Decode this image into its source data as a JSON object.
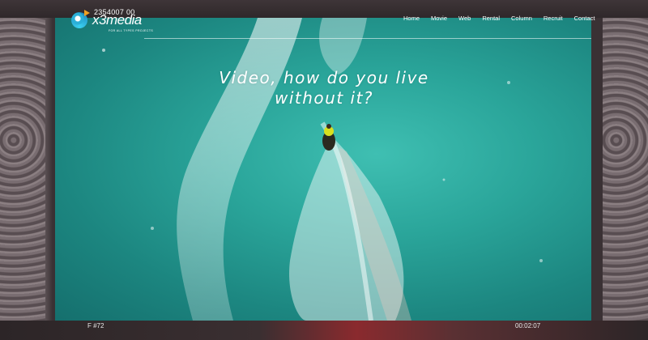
{
  "header": {
    "phone": "2354007 00",
    "logo_text": "x3media",
    "logo_tagline": "FOR ALL TYPES PROJECTS"
  },
  "nav": {
    "items": [
      "Home",
      "Movie",
      "Web",
      "Rental",
      "Column",
      "Recruit",
      "Contact"
    ]
  },
  "hero": {
    "headline_line1": "Video, how do you live",
    "headline_line2": "without it?"
  },
  "footer": {
    "frame_label": "F #72",
    "timecode": "00:02:07"
  },
  "colors": {
    "water": "#2aa59a",
    "frame": "#5e5457",
    "accent_logo": "#f0a020"
  }
}
